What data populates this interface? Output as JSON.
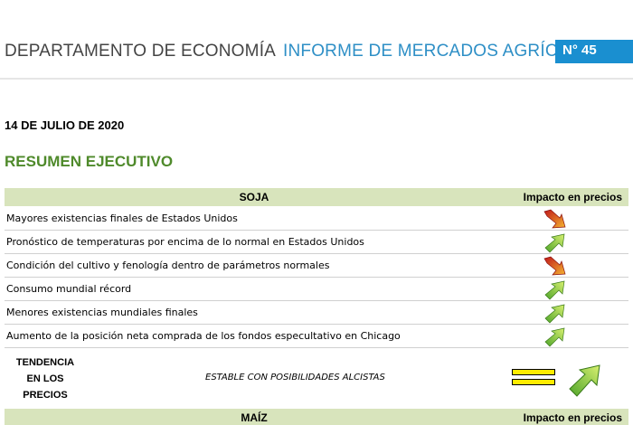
{
  "header": {
    "department": "DEPARTAMENTO DE ECONOMÍA",
    "report_title": "INFORME DE MERCADOS AGRÍCOLAS",
    "number": "N° 45"
  },
  "date": "14 DE JULIO DE 2020",
  "summary_title": "RESUMEN EJECUTIVO",
  "impact_header": "Impacto en precios",
  "soja": {
    "title": "SOJA",
    "factors": [
      {
        "text": "Mayores existencias finales de Estados Unidos",
        "impact": "down-red"
      },
      {
        "text": "Pronóstico de temperaturas por encima de lo normal en Estados Unidos",
        "impact": "up-green"
      },
      {
        "text": "Condición del cultivo y fenología dentro de parámetros normales",
        "impact": "down-red"
      },
      {
        "text": "Consumo mundial récord",
        "impact": "up-green"
      },
      {
        "text": "Menores existencias mundiales finales",
        "impact": "up-green"
      },
      {
        "text": "Aumento de la posición neta comprada de los fondos especultativo en Chicago",
        "impact": "up-green"
      }
    ],
    "trend_label_lines": [
      "TENDENCIA",
      "EN LOS",
      "PRECIOS"
    ],
    "trend_value": "ESTABLE CON POSIBILIDADES ALCISTAS",
    "trend_icons": [
      "equal-icon",
      "up-arrow-icon"
    ]
  },
  "maiz": {
    "title": "MAÍZ"
  },
  "colors": {
    "section_bg": "#d8e4bc",
    "summary_green": "#4f8a2b",
    "badge_blue": "#1a8fd0",
    "arrow_green": "#7dc242",
    "arrow_red": "#d0312d"
  }
}
